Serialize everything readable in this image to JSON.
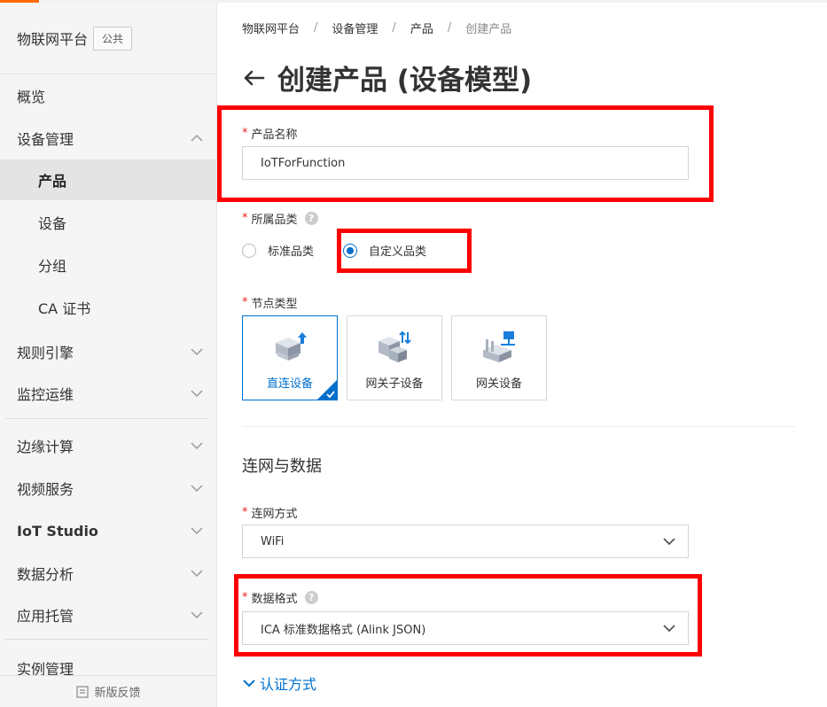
{
  "sidebar": {
    "title": "物联网平台",
    "badge": "公共",
    "items": [
      {
        "label": "概览"
      },
      {
        "label": "设备管理"
      },
      {
        "label": "产品"
      },
      {
        "label": "设备"
      },
      {
        "label": "分组"
      },
      {
        "label": "CA 证书"
      },
      {
        "label": "规则引擎"
      },
      {
        "label": "监控运维"
      },
      {
        "label": "边缘计算"
      },
      {
        "label": "视频服务"
      },
      {
        "label": "IoT Studio"
      },
      {
        "label": "数据分析"
      },
      {
        "label": "应用托管"
      },
      {
        "label": "实例管理"
      }
    ],
    "footer": "新版反馈"
  },
  "breadcrumb": [
    "物联网平台",
    "设备管理",
    "产品",
    "创建产品"
  ],
  "page_title": "创建产品 (设备模型)",
  "form": {
    "product_name": {
      "label": "产品名称",
      "value": "IoTForFunction"
    },
    "category": {
      "label": "所属品类",
      "options": [
        {
          "label": "标准品类",
          "checked": false
        },
        {
          "label": "自定义品类",
          "checked": true
        }
      ]
    },
    "node_type": {
      "label": "节点类型",
      "options": [
        {
          "label": "直连设备",
          "selected": true
        },
        {
          "label": "网关子设备",
          "selected": false
        },
        {
          "label": "网关设备",
          "selected": false
        }
      ]
    },
    "section_title": "连网与数据",
    "network": {
      "label": "连网方式",
      "value": "WiFi"
    },
    "data_format": {
      "label": "数据格式",
      "value": "ICA 标准数据格式 (Alink JSON)"
    },
    "auth_link": "认证方式"
  },
  "colors": {
    "accent": "#0070cc",
    "highlight": "#ff0000",
    "brand": "#ff6a00"
  }
}
